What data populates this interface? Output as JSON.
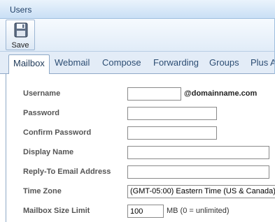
{
  "window": {
    "title": "Users"
  },
  "toolbar": {
    "save_label": "Save"
  },
  "tabs": [
    {
      "label": "Mailbox",
      "active": true
    },
    {
      "label": "Webmail"
    },
    {
      "label": "Compose"
    },
    {
      "label": "Forwarding"
    },
    {
      "label": "Groups"
    },
    {
      "label": "Plus A"
    }
  ],
  "form": {
    "username": {
      "label": "Username",
      "value": "",
      "suffix": "@domainname.com"
    },
    "password": {
      "label": "Password",
      "value": ""
    },
    "confirm_password": {
      "label": "Confirm Password",
      "value": ""
    },
    "display_name": {
      "label": "Display Name",
      "value": ""
    },
    "reply_to": {
      "label": "Reply-To Email Address",
      "value": ""
    },
    "time_zone": {
      "label": "Time Zone",
      "value": "(GMT-05:00) Eastern Time (US & Canada)"
    },
    "mailbox_size": {
      "label": "Mailbox Size Limit",
      "value": "100",
      "suffix": "MB (0 = unlimited)"
    }
  },
  "colors": {
    "accent": "#c9dff5",
    "tab_text": "#2c4d73",
    "label_text": "#555555"
  },
  "icons": {
    "save": "floppy-disk-icon"
  }
}
